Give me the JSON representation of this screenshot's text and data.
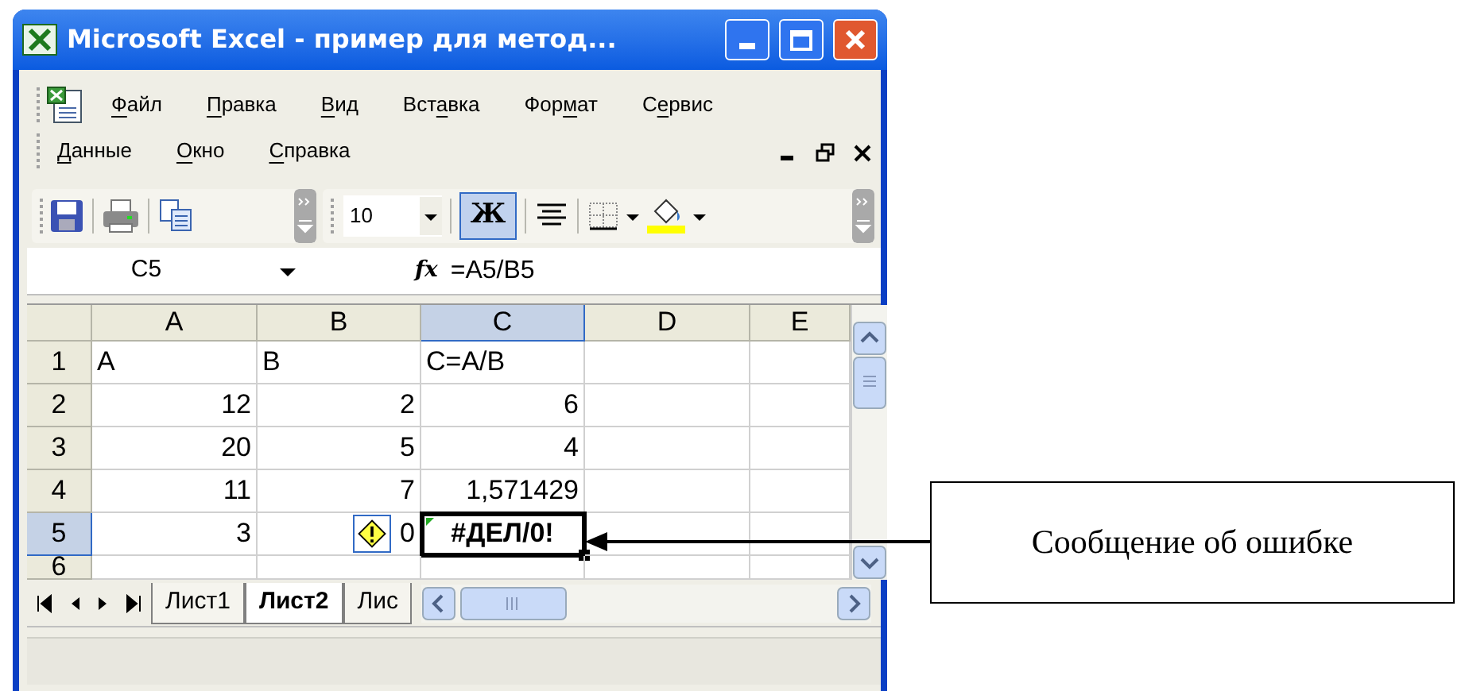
{
  "window": {
    "title": "Microsoft Excel - пример для метод..."
  },
  "menu_rows": [
    [
      {
        "parts": [
          {
            "text": "Ф",
            "underlined": true
          },
          {
            "text": "айл",
            "underlined": false
          }
        ]
      },
      {
        "parts": [
          {
            "text": "П",
            "underlined": true
          },
          {
            "text": "равка",
            "underlined": false
          }
        ]
      },
      {
        "parts": [
          {
            "text": "В",
            "underlined": true
          },
          {
            "text": "ид",
            "underlined": false
          }
        ]
      },
      {
        "parts": [
          {
            "text": "Вст",
            "underlined": false
          },
          {
            "text": "а",
            "underlined": true
          },
          {
            "text": "вка",
            "underlined": false
          }
        ]
      },
      {
        "parts": [
          {
            "text": "Фор",
            "underlined": false
          },
          {
            "text": "м",
            "underlined": true
          },
          {
            "text": "ат",
            "underlined": false
          }
        ]
      },
      {
        "parts": [
          {
            "text": "С",
            "underlined": false
          },
          {
            "text": "е",
            "underlined": true
          },
          {
            "text": "рвис",
            "underlined": false
          }
        ]
      }
    ],
    [
      {
        "parts": [
          {
            "text": "Д",
            "underlined": true
          },
          {
            "text": "анные",
            "underlined": false
          }
        ]
      },
      {
        "parts": [
          {
            "text": "О",
            "underlined": true
          },
          {
            "text": "кно",
            "underlined": false
          }
        ]
      },
      {
        "parts": [
          {
            "text": "С",
            "underlined": true
          },
          {
            "text": "правка",
            "underlined": false
          }
        ]
      }
    ]
  ],
  "toolbar": {
    "font_size": "10",
    "bold": {
      "label": "Ж",
      "pressed": true
    }
  },
  "formula_bar": {
    "name_box": "C5",
    "fx": "fx",
    "formula": "=A5/B5"
  },
  "columns": [
    {
      "label": "A",
      "selected": false
    },
    {
      "label": "B",
      "selected": false
    },
    {
      "label": "C",
      "selected": true
    },
    {
      "label": "D",
      "selected": false
    },
    {
      "label": "E",
      "selected": false
    }
  ],
  "rows": [
    {
      "label": "1",
      "selected": false,
      "cells": [
        {
          "text": "A",
          "numeric": false
        },
        {
          "text": "B",
          "numeric": false
        },
        {
          "text": "C=A/B",
          "numeric": false
        }
      ]
    },
    {
      "label": "2",
      "selected": false,
      "cells": [
        {
          "text": "12",
          "numeric": true
        },
        {
          "text": "2",
          "numeric": true
        },
        {
          "text": "6",
          "numeric": true
        }
      ]
    },
    {
      "label": "3",
      "selected": false,
      "cells": [
        {
          "text": "20",
          "numeric": true
        },
        {
          "text": "5",
          "numeric": true
        },
        {
          "text": "4",
          "numeric": true
        }
      ]
    },
    {
      "label": "4",
      "selected": false,
      "cells": [
        {
          "text": "11",
          "numeric": true
        },
        {
          "text": "7",
          "numeric": true
        },
        {
          "text": "1,571429",
          "numeric": true
        }
      ]
    },
    {
      "label": "5",
      "selected": true,
      "cells": [
        {
          "text": "3",
          "numeric": true
        },
        {
          "text": "0",
          "numeric": true,
          "smart_tag": true
        },
        {
          "text": "#ДЕЛ/0!",
          "numeric": false,
          "error": true,
          "active": true
        }
      ]
    },
    {
      "label": "6",
      "selected": false,
      "cells": []
    }
  ],
  "sheet_tabs": [
    {
      "label": "Лист1",
      "selected": false
    },
    {
      "label": "Лист2",
      "selected": true
    },
    {
      "label": "Лис",
      "selected": false
    }
  ],
  "callout": {
    "text": "Сообщение об ошибке"
  }
}
